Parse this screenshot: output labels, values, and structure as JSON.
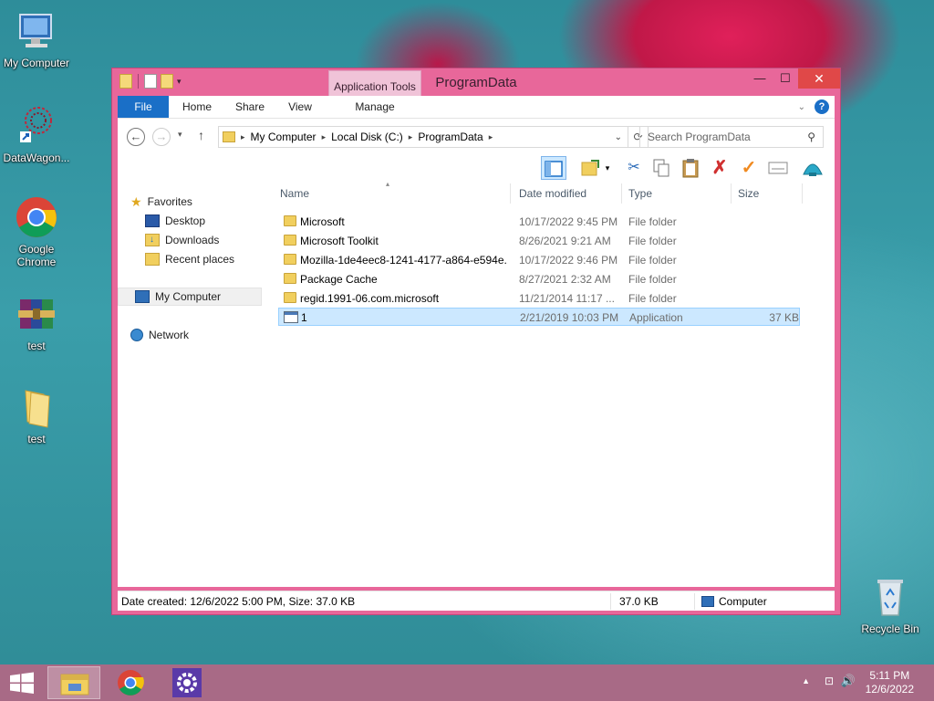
{
  "desktop": {
    "icons": [
      {
        "label": "My Computer"
      },
      {
        "label": "DataWagon..."
      },
      {
        "label": "Google Chrome"
      },
      {
        "label": "test"
      },
      {
        "label": "test"
      },
      {
        "label": "Recycle Bin"
      }
    ]
  },
  "window": {
    "title": "ProgramData",
    "context_tab_group": "Application Tools",
    "tabs": [
      "File",
      "Home",
      "Share",
      "View",
      "Manage"
    ],
    "breadcrumb": [
      "My Computer",
      "Local Disk (C:)",
      "ProgramData"
    ],
    "search_placeholder": "Search ProgramData",
    "nav": {
      "favorites": "Favorites",
      "desktop": "Desktop",
      "downloads": "Downloads",
      "recent": "Recent places",
      "my_computer": "My Computer",
      "network": "Network"
    },
    "columns": {
      "name": "Name",
      "date": "Date modified",
      "type": "Type",
      "size": "Size"
    },
    "files": [
      {
        "name": "Microsoft",
        "date": "10/17/2022 9:45 PM",
        "type": "File folder",
        "size": "",
        "kind": "folder"
      },
      {
        "name": "Microsoft Toolkit",
        "date": "8/26/2021 9:21 AM",
        "type": "File folder",
        "size": "",
        "kind": "folder"
      },
      {
        "name": "Mozilla-1de4eec8-1241-4177-a864-e594e...",
        "date": "10/17/2022 9:46 PM",
        "type": "File folder",
        "size": "",
        "kind": "folder"
      },
      {
        "name": "Package Cache",
        "date": "8/27/2021 2:32 AM",
        "type": "File folder",
        "size": "",
        "kind": "folder"
      },
      {
        "name": "regid.1991-06.com.microsoft",
        "date": "11/21/2014 11:17 ...",
        "type": "File folder",
        "size": "",
        "kind": "folder"
      },
      {
        "name": "1",
        "date": "2/21/2019 10:03 PM",
        "type": "Application",
        "size": "37 KB",
        "kind": "app"
      }
    ],
    "status": {
      "details": "Date created: 12/6/2022 5:00 PM, Size: 37.0 KB",
      "size": "37.0 KB",
      "location": "Computer"
    }
  },
  "taskbar": {
    "time": "5:11 PM",
    "date": "12/6/2022"
  },
  "colors": {
    "window_frame": "#e8679a",
    "accent": "#1a6fc7",
    "selection": "#cce8ff",
    "taskbar": "#a86a86"
  }
}
